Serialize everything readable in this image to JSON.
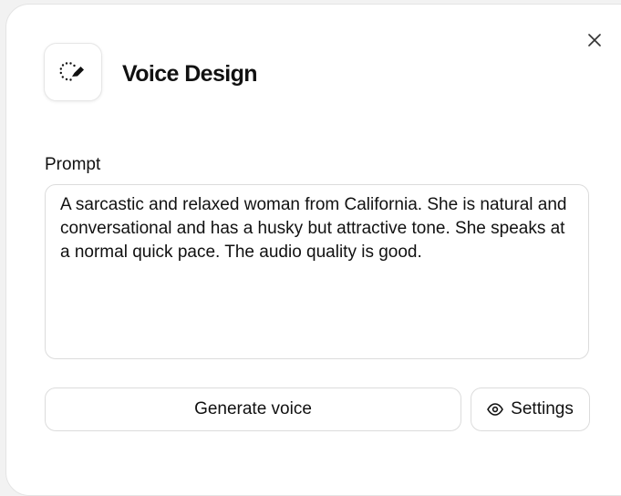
{
  "dialog": {
    "title": "Voice Design",
    "icon": "sparkle-pen-icon",
    "close_icon": "close-icon"
  },
  "prompt": {
    "label": "Prompt",
    "value": "A sarcastic and relaxed woman from California. She is natural and conversational and has a husky but attractive tone. She speaks at a normal quick pace. The audio quality is good."
  },
  "actions": {
    "generate_label": "Generate voice",
    "settings_label": "Settings",
    "settings_icon": "eye-icon"
  }
}
